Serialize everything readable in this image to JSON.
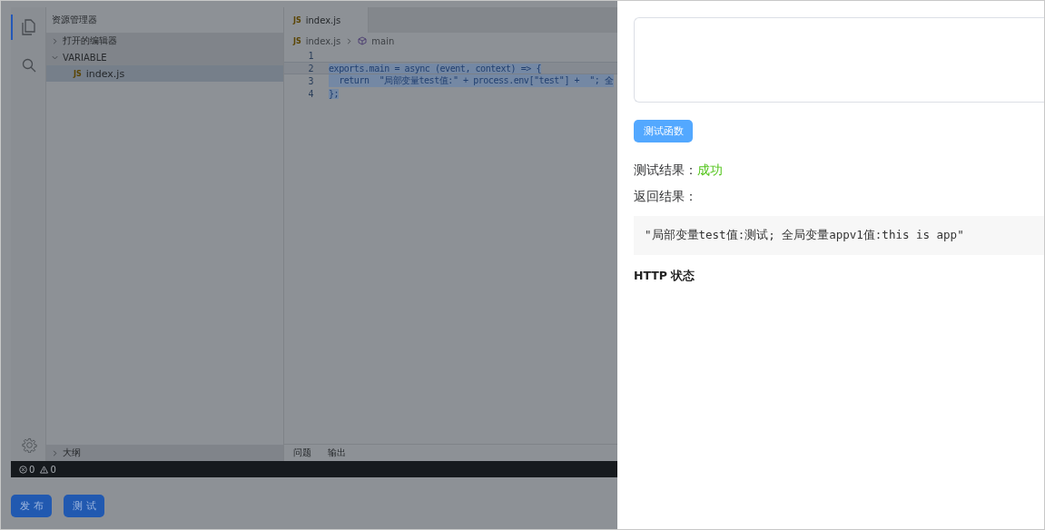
{
  "sidebar": {
    "title": "资源管理器",
    "sections": [
      {
        "label": "打开的编辑器",
        "expanded": false
      },
      {
        "label": "VARIABLE",
        "expanded": true,
        "files": [
          {
            "badge": "JS",
            "label": "index.js",
            "selected": true
          }
        ]
      }
    ],
    "outline": {
      "label": "大纲",
      "expanded": false
    }
  },
  "editor": {
    "tabs": [
      {
        "badge": "JS",
        "label": "index.js",
        "selected": true
      }
    ],
    "breadcrumb": {
      "badge": "JS",
      "file": "index.js",
      "symbol": "main"
    },
    "lines": [
      {
        "number": "1",
        "current": false,
        "selected": false
      },
      {
        "number": "2",
        "code": "exports.main = async (event, context) => {",
        "current": true,
        "selected": true
      },
      {
        "number": "3",
        "code": "  return  \"局部变量test值:\" + process.env[\"test\"] +  \"; 全",
        "current": false,
        "selected": true
      },
      {
        "number": "4",
        "code": "};",
        "current": false,
        "selected": true
      }
    ]
  },
  "panel": {
    "tabs": [
      "问题",
      "输出"
    ]
  },
  "status_bar": {
    "errors": "0",
    "warnings": "0"
  },
  "actions": [
    "发布",
    "测试"
  ],
  "drawer": {
    "test_button": "测试函数",
    "result_label": "测试结果：",
    "result_value": "成功",
    "return_label": "返回结果：",
    "return_value": "\"局部变量test值:测试; 全局变量appv1值:this is app\"",
    "http_label": "HTTP 状态"
  }
}
